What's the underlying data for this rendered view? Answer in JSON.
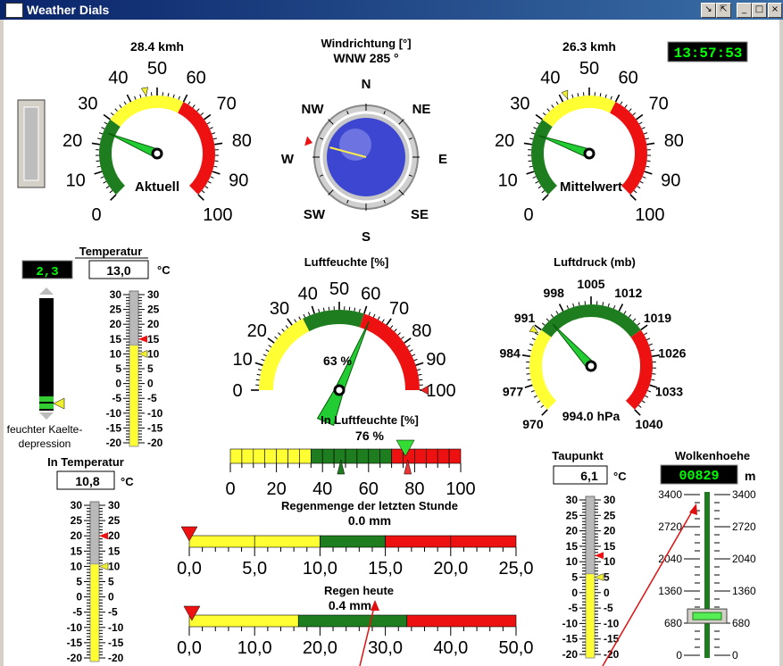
{
  "window": {
    "title": "Weather Dials",
    "buttons": {
      "restore": "↘",
      "pin": "⇱",
      "minimize": "_",
      "maximize": "□",
      "close": "×"
    }
  },
  "clock": "13:57:53",
  "wind_current": {
    "speed": "28.4 kmh",
    "label": "Aktuell",
    "value": 25,
    "ticks": [
      "0",
      "10",
      "20",
      "30",
      "40",
      "50",
      "60",
      "70",
      "80",
      "90",
      "100"
    ]
  },
  "wind_avg": {
    "speed": "26.3 kmh",
    "label": "Mittelwert",
    "value": 24,
    "ticks": [
      "0",
      "10",
      "20",
      "30",
      "40",
      "50",
      "60",
      "70",
      "80",
      "90",
      "100"
    ]
  },
  "wind_direction": {
    "title": "Windrichtung [°]",
    "value_text": "WNW 285 °",
    "degrees": 285,
    "compass": {
      "n": "N",
      "ne": "NE",
      "e": "E",
      "se": "SE",
      "s": "S",
      "sw": "SW",
      "w": "W",
      "nw": "NW"
    }
  },
  "temperature": {
    "title": "Temperatur",
    "value": "13,0",
    "unit": "°C",
    "depression_value": "2,3",
    "depression_label": "feuchter Kaelte-",
    "depression_label2": "depression",
    "scale": [
      "30",
      "25",
      "20",
      "15",
      "10",
      "5",
      "0",
      "-5",
      "-10",
      "-15",
      "-20"
    ],
    "reading": 13,
    "max_marker": 15,
    "min_marker": 10
  },
  "humidity": {
    "title": "Luftfeuchte [%]",
    "value_text": "63 %",
    "value": 63,
    "ticks": [
      "0",
      "10",
      "20",
      "30",
      "40",
      "50",
      "60",
      "70",
      "80",
      "90",
      "100"
    ]
  },
  "pressure": {
    "title": "Luftdruck (mb)",
    "value_text": "994.0 hPa",
    "value": 994,
    "ticks": [
      "970",
      "977",
      "984",
      "991",
      "998",
      "1005",
      "1012",
      "1019",
      "1026",
      "1033",
      "1040"
    ]
  },
  "indoor_humidity": {
    "title": "In Luftfeuchte [%]",
    "value_text": "76 %",
    "value": 76,
    "ticks": [
      "0",
      "20",
      "40",
      "60",
      "80",
      "100"
    ]
  },
  "rain_hour": {
    "title": "Regenmenge der letzten Stunde",
    "value_text": "0.0 mm",
    "ticks": [
      "0,0",
      "5,0",
      "10,0",
      "15,0",
      "20,0",
      "25,0"
    ]
  },
  "rain_today": {
    "title": "Regen heute",
    "value_text": "0.4 mm",
    "ticks": [
      "0,0",
      "10,0",
      "20,0",
      "30,0",
      "40,0",
      "50,0"
    ]
  },
  "indoor_temperature": {
    "title": "In Temperatur",
    "value": "10,8",
    "unit": "°C",
    "scale": [
      "30",
      "25",
      "20",
      "15",
      "10",
      "5",
      "0",
      "-5",
      "-10",
      "-15",
      "-20"
    ],
    "reading": 10.8,
    "max_marker": 20,
    "min_marker": 10
  },
  "dewpoint": {
    "title": "Taupunkt",
    "value": "6,1",
    "unit": "°C",
    "scale": [
      "30",
      "25",
      "20",
      "15",
      "10",
      "5",
      "0",
      "-5",
      "-10",
      "-15",
      "-20"
    ],
    "reading": 6.1,
    "max_marker": 12,
    "min_marker": 5
  },
  "cloud_height": {
    "title": "Wolkenhoehe",
    "value": "00829",
    "unit": "m",
    "scale": [
      "3400",
      "2720",
      "2040",
      "1360",
      "680",
      "0"
    ],
    "reading": 829
  },
  "colors": {
    "green": "#1e7d1e",
    "yellow": "#ffff33",
    "red": "#ee1111",
    "lcd_bg": "#000000",
    "lcd_fg": "#00ff00"
  }
}
